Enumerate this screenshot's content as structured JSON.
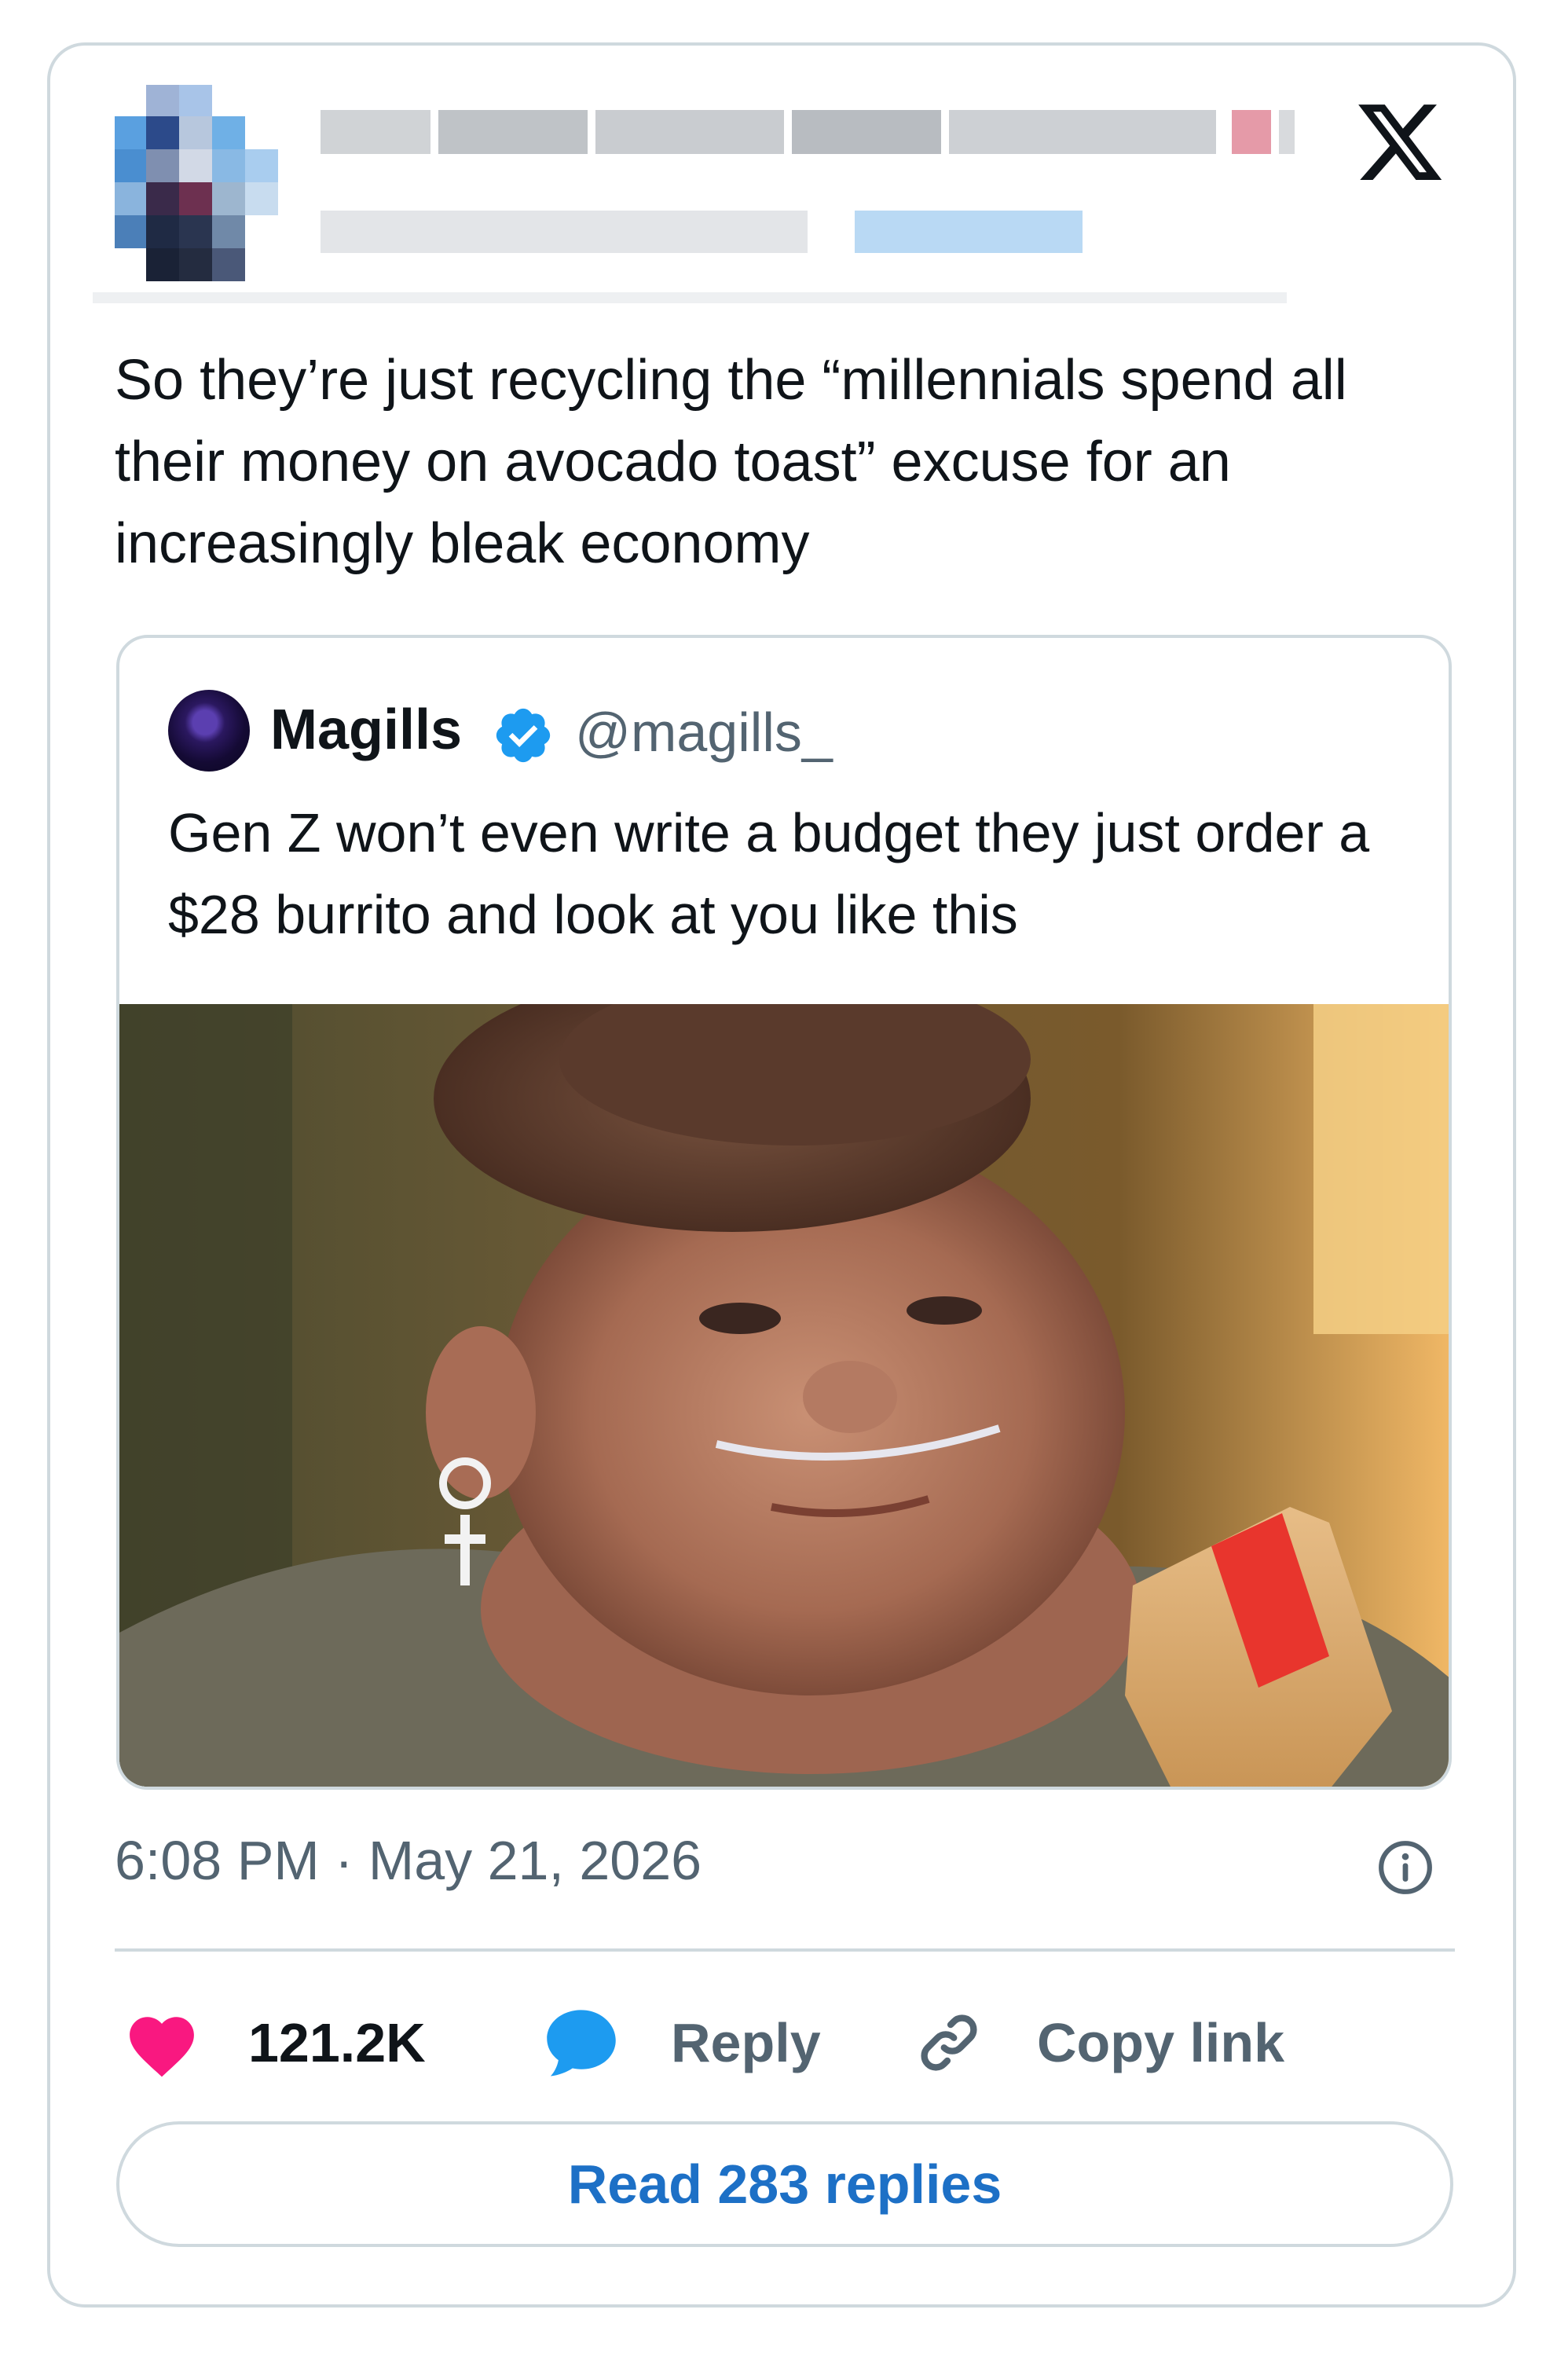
{
  "tweet": {
    "text": "So they’re just recycling the “millennials spend all their money on avocado toast” excuse for an increasingly bleak economy",
    "timestamp": "6:08 PM · May 21, 2026"
  },
  "quoted_tweet": {
    "name": "Magills",
    "handle": "@magills_",
    "text": "Gen Z won’t even write a budget they just order a $28 burrito and look at you like this",
    "verified": true,
    "image_icon": "photo-meme"
  },
  "actions": {
    "like_count": "121.2K",
    "reply_label": "Reply",
    "copy_label": "Copy link"
  },
  "read_replies_label": "Read 283 replies",
  "colors": {
    "like": "#f91880",
    "reply_bubble": "#1d9bf0",
    "verified": "#1d9bf0",
    "link_button": "#1d70c6",
    "secondary_text": "#536471"
  },
  "icons": [
    "x-logo-icon",
    "verified-badge-icon",
    "info-icon",
    "heart-icon",
    "reply-bubble-icon",
    "link-icon"
  ]
}
